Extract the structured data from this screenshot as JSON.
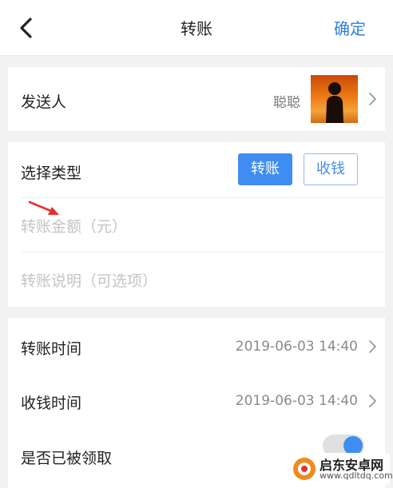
{
  "header": {
    "title": "转账",
    "confirm_label": "确定"
  },
  "sender": {
    "label": "发送人",
    "name": "聪聪"
  },
  "type_selector": {
    "label": "选择类型",
    "options": [
      "转账",
      "收钱"
    ],
    "selected": "转账"
  },
  "amount": {
    "placeholder": "转账金额（元）",
    "value": ""
  },
  "note": {
    "placeholder": "转账说明（可选项）",
    "value": ""
  },
  "transfer_time": {
    "label": "转账时间",
    "value": "2019-06-03 14:40"
  },
  "receive_time": {
    "label": "收钱时间",
    "value": "2019-06-03 14:40"
  },
  "received": {
    "label": "是否已被领取",
    "on": true
  },
  "watermark": {
    "title": "启东安卓网",
    "url": "www.qdltdq.com"
  },
  "colors": {
    "accent": "#3f8df0",
    "background": "#f2f2f2"
  },
  "icons": {
    "back": "chevron-left-icon",
    "row_arrow": "chevron-right-icon"
  }
}
